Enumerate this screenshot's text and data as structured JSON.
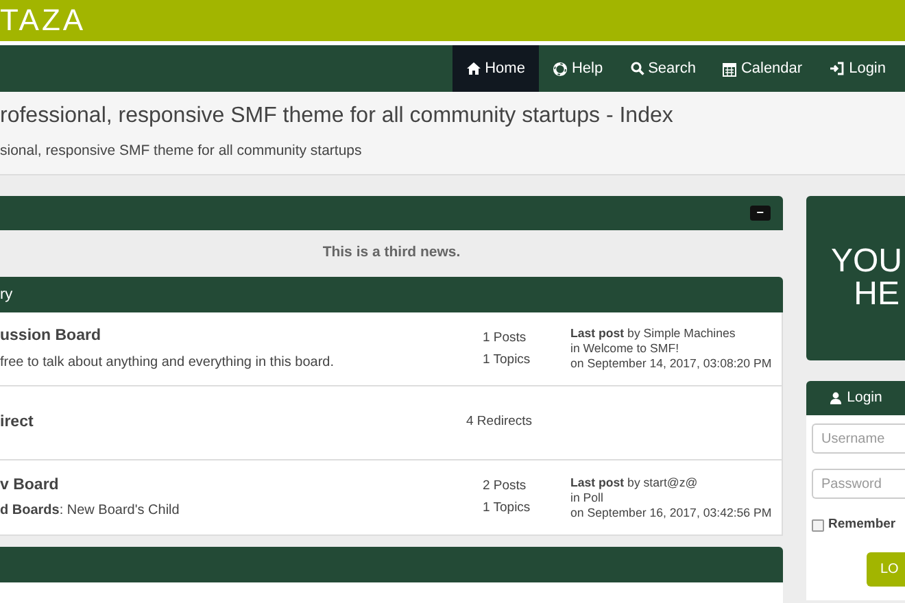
{
  "header": {
    "logo": "TAZA"
  },
  "nav": [
    {
      "label": "Home",
      "kind": "home",
      "selected": true
    },
    {
      "label": "Help",
      "kind": "help",
      "selected": false
    },
    {
      "label": "Search",
      "kind": "search",
      "selected": false
    },
    {
      "label": "Calendar",
      "kind": "calendar",
      "selected": false
    },
    {
      "label": "Login",
      "kind": "login",
      "selected": false
    }
  ],
  "page": {
    "title": "rofessional, responsive SMF theme for all community startups - Index",
    "subtitle": "sional, responsive SMF theme for all community startups"
  },
  "news": {
    "collapse": "−",
    "text": "This is a third news."
  },
  "categories": [
    {
      "title": "ry",
      "boards": [
        {
          "kind": "board",
          "name": "ussion Board",
          "description": "free to talk about anything and everything in this board.",
          "posts": "1 Posts",
          "topics": "1 Topics",
          "last_post": {
            "label": "Last post",
            "by": "by Simple Machines",
            "in": "in Welcome to SMF!",
            "on": "on September 14, 2017, 03:08:20 PM"
          }
        },
        {
          "kind": "redirect",
          "name": "irect",
          "redirects": "4 Redirects"
        },
        {
          "kind": "board",
          "name": "v Board",
          "description": "**d Boards**: New Board's Child",
          "posts": "2 Posts",
          "topics": "1 Topics",
          "last_post": {
            "label": "Last post",
            "by": "by start@z@",
            "in": "in Poll",
            "on": "on September 16, 2017, 03:42:56 PM"
          }
        }
      ]
    }
  ],
  "sidebar": {
    "ad": {
      "lines": [
        "YOU",
        "HE"
      ]
    },
    "login": {
      "title": "Login",
      "username": {
        "placeholder": "Username"
      },
      "password": {
        "placeholder": "Password"
      },
      "remember": {
        "label": "Remember",
        "checked": false
      },
      "button": "LO"
    }
  }
}
